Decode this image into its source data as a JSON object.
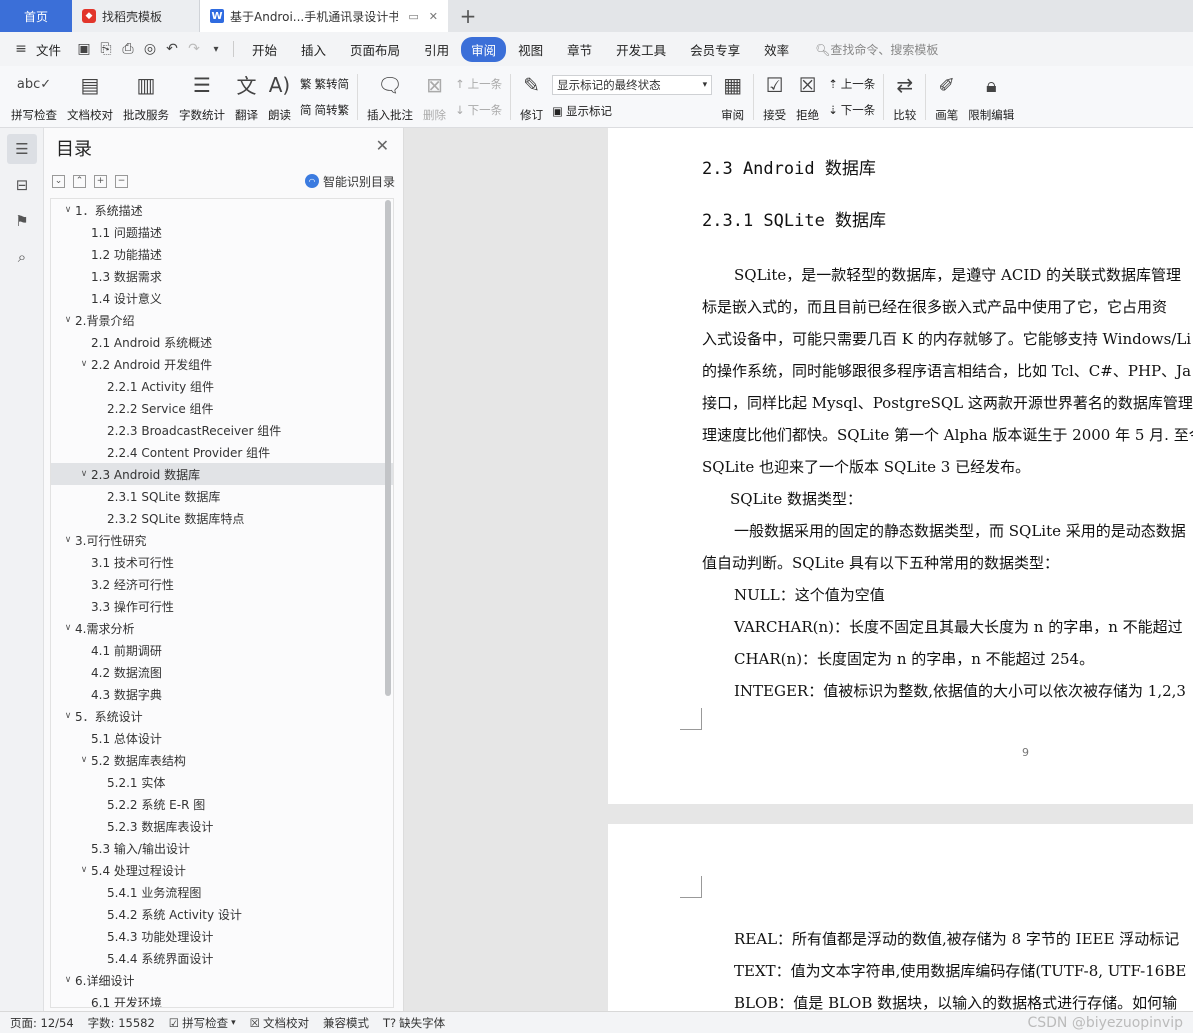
{
  "tabs": {
    "home": "首页",
    "template": "找稻壳模板",
    "doc": "基于Androi...手机通讯录设计书",
    "add": "+"
  },
  "menu": {
    "file": "文件",
    "items": [
      "开始",
      "插入",
      "页面布局",
      "引用",
      "审阅",
      "视图",
      "章节",
      "开发工具",
      "会员专享",
      "效率"
    ],
    "active": "审阅",
    "search": "查找命令、搜索模板"
  },
  "ribbon": {
    "spell": "拼写检查",
    "doc_check": "文档校对",
    "batch": "批改服务",
    "wordcount": "字数统计",
    "translate": "翻译",
    "read": "朗读",
    "trad": "繁转简",
    "simp": "简转繁",
    "insert_comment": "插入批注",
    "delete": "删除",
    "prev": "上一条",
    "next": "下一条",
    "revise": "修订",
    "markup_select": "显示标记的最终状态",
    "show_markup": "显示标记",
    "review": "审阅",
    "accept": "接受",
    "reject": "拒绝",
    "prev2": "上一条",
    "next2": "下一条",
    "compare": "比较",
    "pen": "画笔",
    "restrict": "限制编辑"
  },
  "toc": {
    "title": "目录",
    "smart": "智能识别目录",
    "items": [
      {
        "t": "1．系统描述",
        "lv": 1,
        "arrow": true
      },
      {
        "t": "1.1  问题描述",
        "lv": 2
      },
      {
        "t": "1.2  功能描述",
        "lv": 2
      },
      {
        "t": "1.3  数据需求",
        "lv": 2
      },
      {
        "t": "1.4  设计意义",
        "lv": 2
      },
      {
        "t": "2.背景介绍",
        "lv": 1,
        "arrow": true
      },
      {
        "t": "2.1 Android 系统概述",
        "lv": 2
      },
      {
        "t": "2.2 Android 开发组件",
        "lv": 2,
        "arrow": true
      },
      {
        "t": "2.2.1 Activity 组件",
        "lv": 3
      },
      {
        "t": "2.2.2 Service  组件",
        "lv": 3
      },
      {
        "t": "2.2.3 BroadcastReceiver  组件",
        "lv": 3
      },
      {
        "t": "2.2.4 Content Provider  组件",
        "lv": 3
      },
      {
        "t": "2.3 Android 数据库",
        "lv": 2,
        "arrow": true,
        "selected": true
      },
      {
        "t": "2.3.1 SQLite 数据库",
        "lv": 3
      },
      {
        "t": "2.3.2 SQLite 数据库特点",
        "lv": 3
      },
      {
        "t": "3.可行性研究",
        "lv": 1,
        "arrow": true
      },
      {
        "t": "3.1  技术可行性",
        "lv": 2
      },
      {
        "t": "3.2  经济可行性",
        "lv": 2
      },
      {
        "t": "3.3  操作可行性",
        "lv": 2
      },
      {
        "t": "4.需求分析",
        "lv": 1,
        "arrow": true
      },
      {
        "t": "4.1  前期调研",
        "lv": 2
      },
      {
        "t": "4.2  数据流图",
        "lv": 2
      },
      {
        "t": "4.3  数据字典",
        "lv": 2
      },
      {
        "t": "5．系统设计",
        "lv": 1,
        "arrow": true
      },
      {
        "t": "5.1  总体设计",
        "lv": 2
      },
      {
        "t": "5.2  数据库表结构",
        "lv": 2,
        "arrow": true
      },
      {
        "t": "5.2.1  实体",
        "lv": 3
      },
      {
        "t": "5.2.2  系统 E-R 图",
        "lv": 3
      },
      {
        "t": "5.2.3  数据库表设计",
        "lv": 3
      },
      {
        "t": "5.3  输入/输出设计",
        "lv": 2
      },
      {
        "t": "5.4  处理过程设计",
        "lv": 2,
        "arrow": true
      },
      {
        "t": "5.4.1  业务流程图",
        "lv": 3
      },
      {
        "t": "5.4.2  系统 Activity 设计",
        "lv": 3
      },
      {
        "t": "5.4.3  功能处理设计",
        "lv": 3
      },
      {
        "t": "5.4.4  系统界面设计",
        "lv": 3
      },
      {
        "t": "6.详细设计",
        "lv": 1,
        "arrow": true
      },
      {
        "t": "6.1  开发环境",
        "lv": 2
      }
    ]
  },
  "page1": {
    "h2": "2.3 Android 数据库",
    "h3": "2.3.1 SQLite 数据库",
    "lines": [
      "SQLite，是一款轻型的数据库，是遵守 ACID 的关联式数据库管理",
      "标是嵌入式的，而且目前已经在很多嵌入式产品中使用了它，它占用资",
      "入式设备中，可能只需要几百 K 的内存就够了。它能够支持 Windows/Li",
      "的操作系统，同时能够跟很多程序语言相结合，比如  Tcl、C#、PHP、Ja",
      "接口，同样比起 Mysql、PostgreSQL 这两款开源世界著名的数据库管理",
      "理速度比他们都快。SQLite 第一个 Alpha 版本诞生于 2000 年 5 月. 至今",
      "SQLite 也迎来了一个版本  SQLite 3 已经发布。",
      "SQLite 数据类型：",
      "一般数据采用的固定的静态数据类型，而 SQLite 采用的是动态数据",
      "值自动判断。SQLite 具有以下五种常用的数据类型：",
      "NULL：这个值为空值",
      "VARCHAR(n)：长度不固定且其最大长度为 n 的字串，n 不能超过",
      "CHAR(n)：长度固定为 n 的字串，n 不能超过  254。",
      "INTEGER：值被标识为整数,依据值的大小可以依次被存储为 1,2,3"
    ],
    "page_number": "9"
  },
  "page2": {
    "lines": [
      "REAL：所有值都是浮动的数值,被存储为 8 字节的 IEEE 浮动标记",
      "TEXT：值为文本字符串,使用数据库编码存储(TUTF-8, UTF-16BE",
      "BLOB：值是 BLOB 数据块，以输入的数据格式进行存储。如何输"
    ]
  },
  "status": {
    "page": "页面: 12/54",
    "words": "字数: 15582",
    "spell": "拼写检查",
    "doc_check": "文档校对",
    "compat": "兼容模式",
    "missing_font": "缺失字体",
    "watermark": "CSDN @biyezuopinvip"
  }
}
